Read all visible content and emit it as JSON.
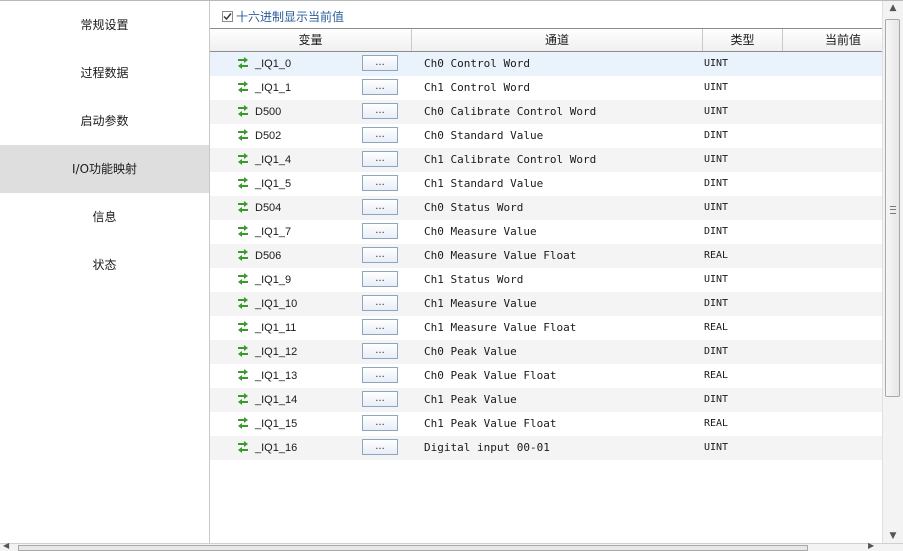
{
  "sidebar": {
    "items": [
      {
        "label": "常规设置",
        "active": false
      },
      {
        "label": "过程数据",
        "active": false
      },
      {
        "label": "启动参数",
        "active": false
      },
      {
        "label": "I/O功能映射",
        "active": true
      },
      {
        "label": "信息",
        "active": false
      },
      {
        "label": "状态",
        "active": false
      }
    ]
  },
  "options": {
    "hex_checkbox_label": "十六进制显示当前值",
    "hex_checked": true
  },
  "table": {
    "columns": [
      "变量",
      "通道",
      "类型",
      "当前值"
    ],
    "browse_label": "...",
    "rows": [
      {
        "variable": "_IQ1_0",
        "channel": "Ch0 Control Word",
        "type": "UINT"
      },
      {
        "variable": "_IQ1_1",
        "channel": "Ch1 Control Word",
        "type": "UINT"
      },
      {
        "variable": "D500",
        "channel": "Ch0 Calibrate Control Word",
        "type": "UINT"
      },
      {
        "variable": "D502",
        "channel": "Ch0 Standard Value",
        "type": "DINT"
      },
      {
        "variable": "_IQ1_4",
        "channel": "Ch1 Calibrate Control Word",
        "type": "UINT"
      },
      {
        "variable": "_IQ1_5",
        "channel": "Ch1 Standard Value",
        "type": "DINT"
      },
      {
        "variable": "D504",
        "channel": "Ch0 Status Word",
        "type": "UINT"
      },
      {
        "variable": "_IQ1_7",
        "channel": "Ch0 Measure Value",
        "type": "DINT"
      },
      {
        "variable": "D506",
        "channel": "Ch0 Measure Value Float",
        "type": "REAL"
      },
      {
        "variable": "_IQ1_9",
        "channel": "Ch1 Status Word",
        "type": "UINT"
      },
      {
        "variable": "_IQ1_10",
        "channel": "Ch1 Measure Value",
        "type": "DINT"
      },
      {
        "variable": "_IQ1_11",
        "channel": "Ch1 Measure Value Float",
        "type": "REAL"
      },
      {
        "variable": "_IQ1_12",
        "channel": "Ch0 Peak Value",
        "type": "DINT"
      },
      {
        "variable": "_IQ1_13",
        "channel": "Ch0 Peak Value Float",
        "type": "REAL"
      },
      {
        "variable": "_IQ1_14",
        "channel": "Ch1 Peak Value",
        "type": "DINT"
      },
      {
        "variable": "_IQ1_15",
        "channel": "Ch1 Peak Value Float",
        "type": "REAL"
      },
      {
        "variable": "_IQ1_16",
        "channel": "Digital input 00-01",
        "type": "UINT"
      }
    ]
  },
  "icons": {
    "row_icon": "sync-arrows-icon",
    "sync_color": "#3a9a2e"
  }
}
